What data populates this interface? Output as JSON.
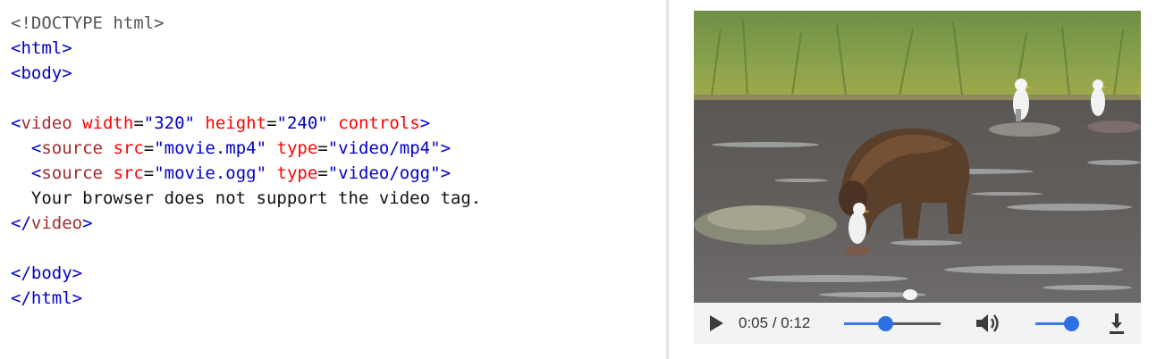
{
  "code": {
    "doctype": "<!DOCTYPE html>",
    "open_html": "html",
    "open_body": "body",
    "video_tag": "video",
    "video_attrs": [
      {
        "name": "width",
        "value": "\"320\""
      },
      {
        "name": "height",
        "value": "\"240\""
      },
      {
        "name": "controls"
      }
    ],
    "source1": {
      "tag": "source",
      "src_attr": "src",
      "src": "\"movie.mp4\"",
      "type_attr": "type",
      "type": "\"video/mp4\""
    },
    "source2": {
      "tag": "source",
      "src_attr": "src",
      "src": "\"movie.ogg\"",
      "type_attr": "type",
      "type": "\"video/ogg\""
    },
    "fallback_text": "Your browser does not support the video tag.",
    "close_video": "video",
    "close_body": "body",
    "close_html": "html"
  },
  "player": {
    "current_time": "0:05",
    "separator": " / ",
    "duration": "0:12",
    "progress": 0.43,
    "volume": 1.0,
    "icons": {
      "play": "play-icon",
      "volume": "volume-icon",
      "download": "download-icon"
    }
  }
}
